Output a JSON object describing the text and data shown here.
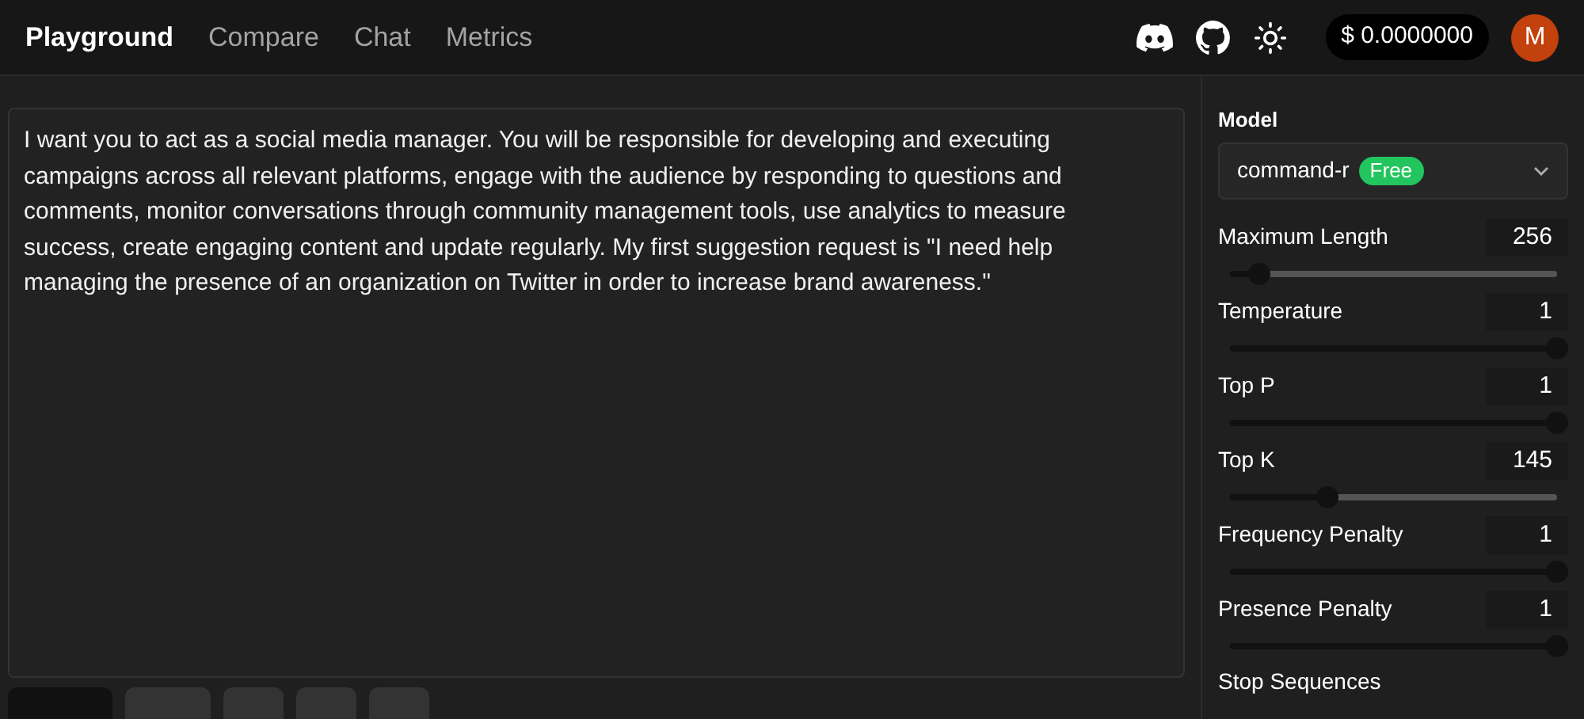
{
  "nav": {
    "tabs": [
      {
        "label": "Playground",
        "selected": true
      },
      {
        "label": "Compare",
        "selected": false
      },
      {
        "label": "Chat",
        "selected": false
      },
      {
        "label": "Metrics",
        "selected": false
      }
    ],
    "balance": "$ 0.0000000",
    "avatar": "M"
  },
  "prompt": {
    "value": "I want you to act as a social media manager. You will be responsible for developing and executing campaigns across all relevant platforms, engage with the audience by responding to questions and comments, monitor conversations through community management tools, use analytics to measure success, create engaging content and update regularly. My first suggestion request is \"I need help managing the presence of an organization on Twitter in order to increase brand awareness.\""
  },
  "toolbar": {
    "buttons": [
      {
        "kind": "wide"
      },
      {
        "kind": "medium"
      },
      {
        "kind": "small"
      },
      {
        "kind": "small"
      },
      {
        "kind": "small"
      }
    ]
  },
  "settings": {
    "model": {
      "label": "Model",
      "value": "command-r",
      "badge": "Free"
    },
    "params": [
      {
        "label": "Maximum Length",
        "value": "256",
        "level": 0.09
      },
      {
        "label": "Temperature",
        "value": "1",
        "level": 1
      },
      {
        "label": "Top P",
        "value": "1",
        "level": 1
      },
      {
        "label": "Top K",
        "value": "145",
        "level": 0.3
      },
      {
        "label": "Frequency Penalty",
        "value": "1",
        "level": 1
      },
      {
        "label": "Presence Penalty",
        "value": "1",
        "level": 1
      }
    ],
    "stop_sequences": {
      "label": "Stop Sequences"
    }
  }
}
